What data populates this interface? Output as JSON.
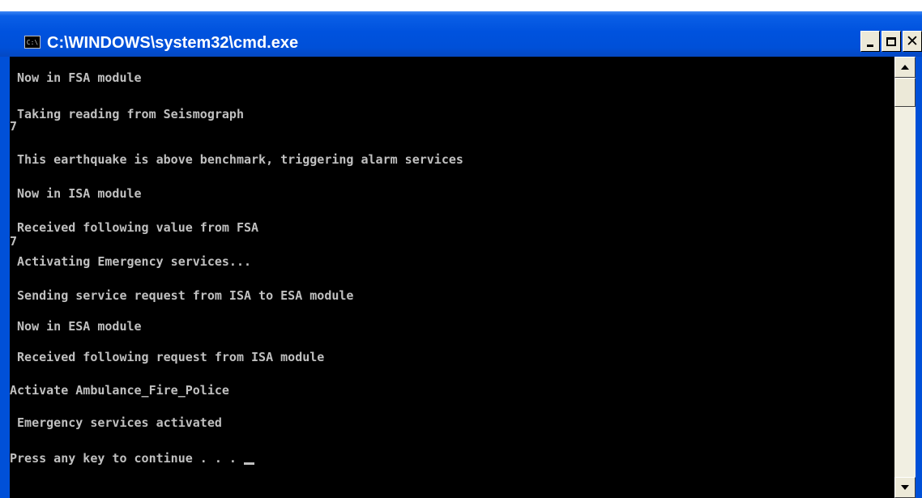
{
  "window": {
    "title": "C:\\WINDOWS\\system32\\cmd.exe",
    "icon": "console-icon",
    "icon_text": "C:\\"
  },
  "console": {
    "lines": [
      " Now in FSA module",
      " Taking reading from Seismograph",
      "7",
      " This earthquake is above benchmark, triggering alarm services",
      " Now in ISA module",
      " Received following value from FSA",
      "7",
      " Activating Emergency services...",
      " Sending service request from ISA to ESA module",
      " Now in ESA module",
      " Received following request from ISA module",
      "Activate Ambulance_Fire_Police",
      " Emergency services activated",
      "Press any key to continue . . . "
    ]
  },
  "colors": {
    "titlebar": "#0054e3",
    "console_bg": "#000000",
    "console_fg": "#c0c0c0"
  }
}
